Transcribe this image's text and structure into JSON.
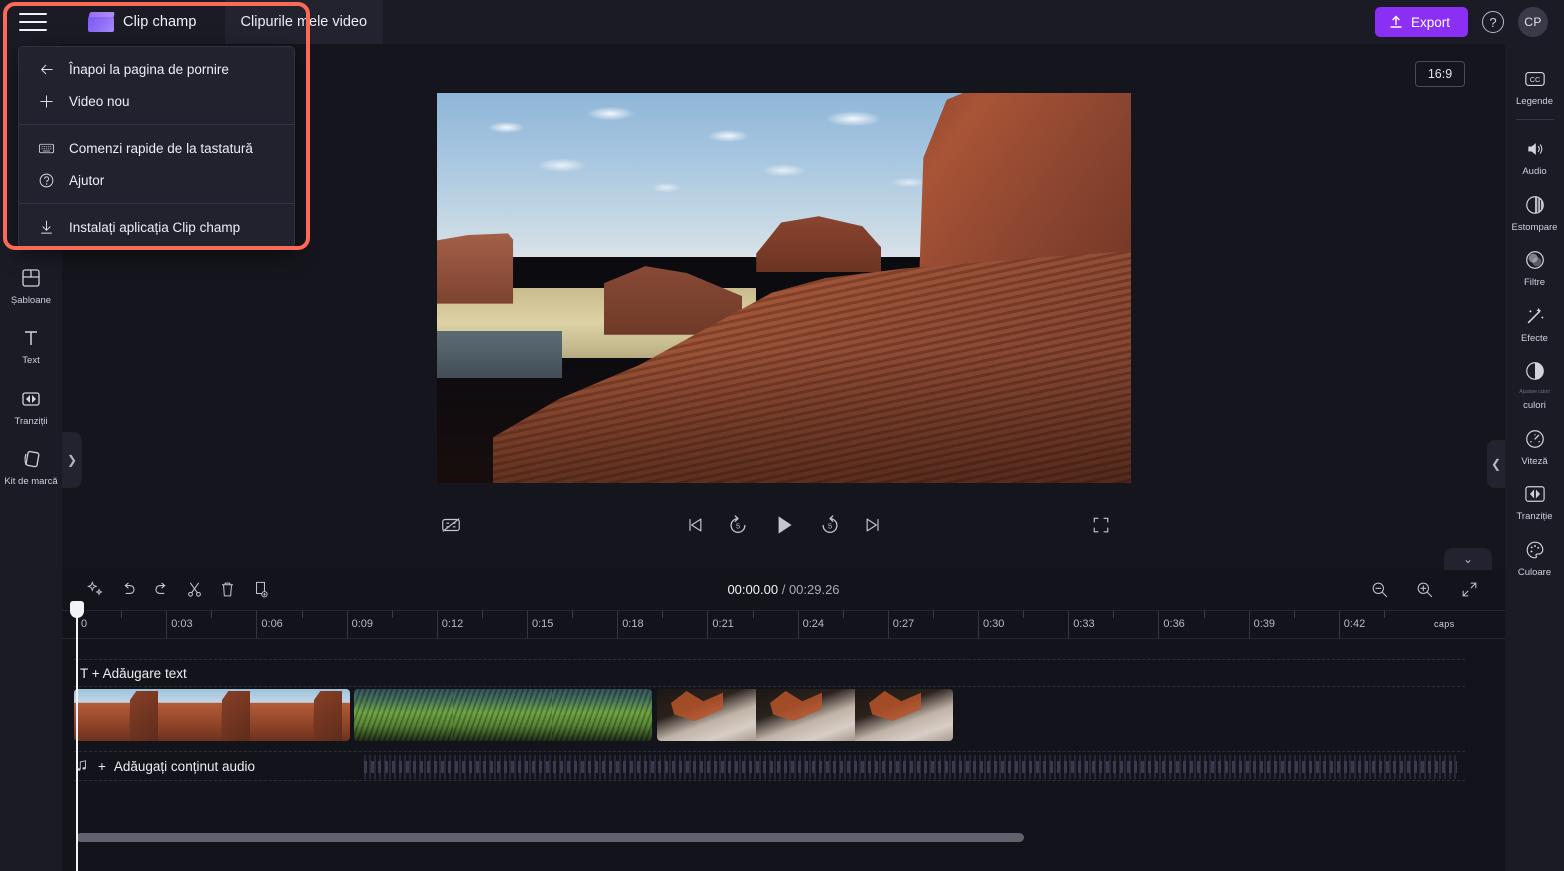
{
  "app": {
    "brand_name": "Clip champ",
    "logo_icon": "clapperboard-icon",
    "hamburger_icon": "hamburger-menu-icon",
    "tab_my_videos": "Clipurile mele video",
    "export_label": "Export",
    "export_icon": "upload-arrow-icon",
    "help_icon": "question-circle-icon",
    "avatar_initials": "CP",
    "accent_purple": "#8b2ff5",
    "highlight_color": "#fa6a57"
  },
  "menu": {
    "items": [
      {
        "label": "Înapoi la pagina de pornire",
        "icon": "arrow-left-icon"
      },
      {
        "label": "Video nou",
        "icon": "plus-icon"
      },
      {
        "label": "Comenzi rapide de la tastatură",
        "icon": "keyboard-icon"
      },
      {
        "label": "Ajutor",
        "icon": "question-circle-icon"
      },
      {
        "label": "Instalați aplicația Clip champ",
        "icon": "download-icon"
      }
    ]
  },
  "left_rail": {
    "items": [
      {
        "label": "Șabloane",
        "icon": "templates-grid-icon"
      },
      {
        "label": "Text",
        "icon": "text-T-icon"
      },
      {
        "label": "Tranziții",
        "icon": "transitions-icon"
      },
      {
        "label": "Kit de marcă",
        "icon": "brand-kit-icon"
      }
    ],
    "collapse_icon": "chevron-right-icon"
  },
  "right_rail": {
    "items": [
      {
        "label": "Legende",
        "icon": "closed-caption-icon",
        "sub": ""
      },
      {
        "label": "Audio",
        "icon": "speaker-icon",
        "sub": ""
      },
      {
        "label": "Estompare",
        "icon": "blur-circle-icon",
        "sub": ""
      },
      {
        "label": "Filtre",
        "icon": "filters-circles-icon",
        "sub": ""
      },
      {
        "label": "Efecte",
        "icon": "magic-wand-icon",
        "sub": ""
      },
      {
        "label": "culori",
        "icon": "contrast-circle-icon",
        "sub": "Ajustare culori"
      },
      {
        "label": "Viteză",
        "icon": "speedometer-icon",
        "sub": ""
      },
      {
        "label": "Tranziție",
        "icon": "transitions-icon",
        "sub": ""
      },
      {
        "label": "Culoare",
        "icon": "palette-icon",
        "sub": ""
      }
    ],
    "collapse_icon": "chevron-left-icon",
    "collapse_down_icon": "chevron-down-icon"
  },
  "stage": {
    "aspect_ratio": "16:9",
    "preview_alt": "Canyon mesa landscape with red rock cliffs and cloudy blue sky"
  },
  "player": {
    "captions_toggle_icon": "captions-off-icon",
    "skip_start_icon": "skip-to-start-icon",
    "back5_icon": "rewind-5-icon",
    "play_icon": "play-icon",
    "forward5_icon": "forward-5-icon",
    "skip_end_icon": "skip-to-end-icon",
    "fullscreen_icon": "fullscreen-icon"
  },
  "timeline": {
    "tools": [
      {
        "icon": "auto-compose-sparkle-icon",
        "name": "auto-compose"
      },
      {
        "icon": "undo-icon",
        "name": "undo"
      },
      {
        "icon": "redo-icon",
        "name": "redo"
      },
      {
        "icon": "scissors-icon",
        "name": "split"
      },
      {
        "icon": "trash-icon",
        "name": "delete"
      },
      {
        "icon": "duplicate-icon",
        "name": "duplicate"
      }
    ],
    "current_time": "00:00.00",
    "separator": "/",
    "total_time": "00:29.26",
    "zoom_out_icon": "zoom-out-icon",
    "zoom_in_icon": "zoom-in-icon",
    "fit_icon": "fit-to-screen-icon",
    "ruler_ticks": [
      "0",
      "0:03",
      "0:06",
      "0:09",
      "0:12",
      "0:15",
      "0:18",
      "0:21",
      "0:24",
      "0:27",
      "0:30",
      "0:33",
      "0:36",
      "0:39",
      "0:42"
    ],
    "caps_marker": "caps",
    "track_text_label": "T + Adăugare text",
    "track_audio_label": "Adăugați conținut audio",
    "track_audio_icon": "music-note-icon",
    "track_audio_plus": "+",
    "clips": [
      {
        "name": "canyon-clip",
        "thumb": "canyon",
        "frames": 3
      },
      {
        "name": "green-hills-clip",
        "thumb": "green",
        "frames": 3
      },
      {
        "name": "rock-aerial-clip",
        "thumb": "rock",
        "frames": 3
      }
    ]
  }
}
